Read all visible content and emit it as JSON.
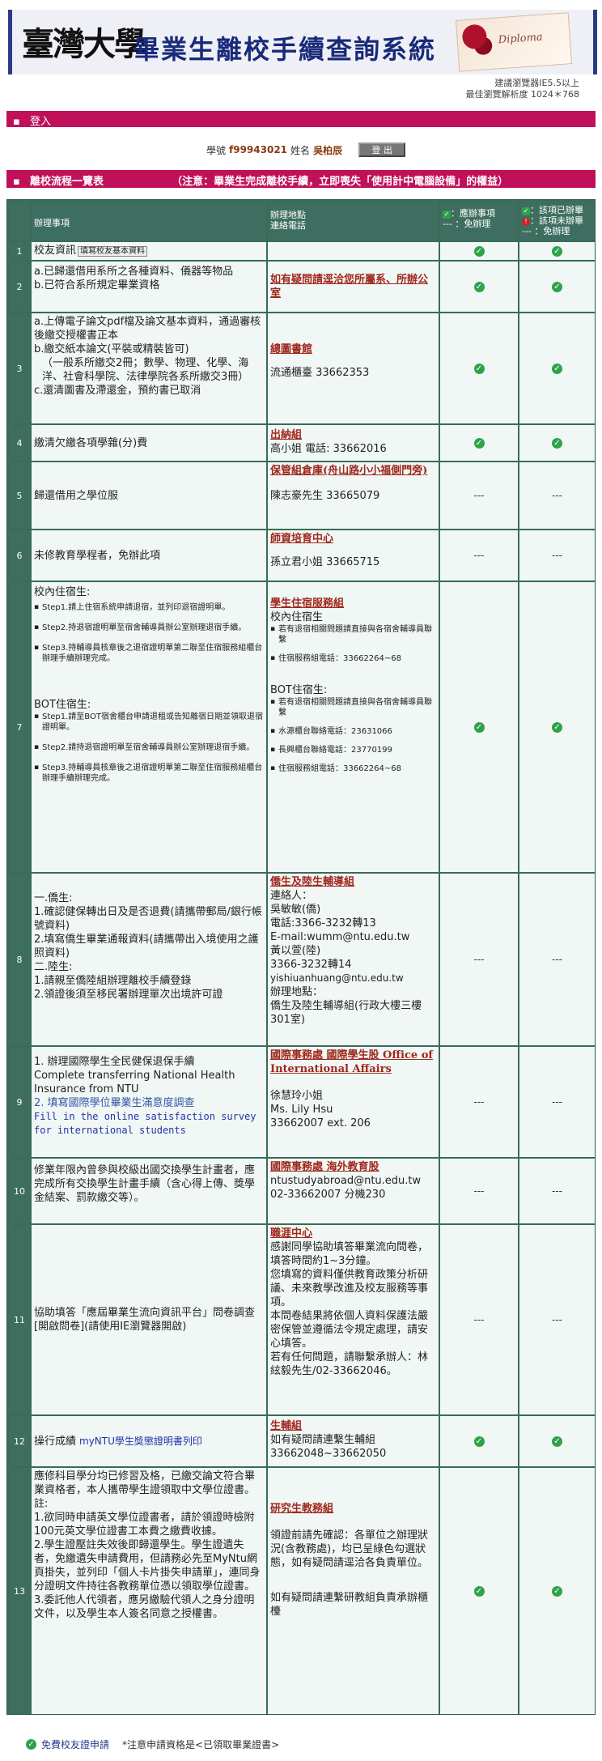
{
  "header": {
    "logo": "臺灣大學",
    "title": "畢業生離校手續查詢系統",
    "diploma_word": "Diploma",
    "browser_line1": "建議瀏覽器IE5.5以上",
    "browser_line2": "最佳瀏覽解析度 1024＊768"
  },
  "login_bar": {
    "label": "登入"
  },
  "student": {
    "id_label": "學號",
    "id_value": "f99943021",
    "name_label": "姓名",
    "name_value": "吳柏辰",
    "logout_label": "登 出"
  },
  "flow_bar": {
    "label": "離校流程一覽表",
    "note": "（注意：畢業生完成離校手續，立即喪失「使用計中電腦設備」的權益）"
  },
  "table": {
    "headers": {
      "item": "辦理事項",
      "contact": "辦理地點\n連絡電話",
      "col_a_line1": "：應辦事項",
      "col_a_line2": "--- ：免辦理",
      "col_b_line1": "：該項已辦畢",
      "col_b_line2": "：該項未辦畢",
      "col_b_line3": "--- ：免辦理"
    },
    "rows": [
      {
        "num": "1",
        "item": "校友資訊",
        "item_button": "填寫校友基本資料",
        "contact": "",
        "a": "check",
        "b": "check"
      },
      {
        "num": "2",
        "item_lines": [
          "a.已歸還借用系所之各種資料、儀器等物品",
          "b.已符合系所規定畢業資格"
        ],
        "contact_unit": "如有疑問請逕洽您所屬系、所辦公室",
        "a": "check",
        "b": "check"
      },
      {
        "num": "3",
        "item_lines": [
          "a.上傳電子論文pdf檔及論文基本資料，通過審核後繳交授權書正本",
          "b.繳交紙本論文(平裝或精裝皆可)",
          "（一般系所繳交2冊；數學、物理、化學、海洋、社會科學院、法律學院各系所繳交3冊）",
          "c.還清圖書及滯還金，預約書已取消"
        ],
        "contact_unit": "總圖書館",
        "contact_lines": [
          "流通櫃臺 33662353"
        ],
        "a": "check",
        "b": "check"
      },
      {
        "num": "4",
        "item": "繳清欠繳各項學雜(分)費",
        "contact_unit": "出納組",
        "contact_lines": [
          "高小姐 電話: 33662016"
        ],
        "a": "check",
        "b": "check"
      },
      {
        "num": "5",
        "item": "歸還借用之學位服",
        "contact_unit": "保管組倉庫(舟山路小小福側門旁)",
        "contact_lines": [
          "陳志豪先生 33665079"
        ],
        "a": "---",
        "b": "---"
      },
      {
        "num": "6",
        "item": "未修教育學程者，免辦此項",
        "contact_unit": "師資培育中心",
        "contact_lines": [
          "孫立君小姐 33665715"
        ],
        "a": "---",
        "b": "---"
      },
      {
        "num": "7",
        "item_campus_title": "校內住宿生:",
        "item_campus_steps": [
          "Step1.請上住宿系統申請退宿，並列印退宿證明單。",
          "Step2.持退宿證明單至宿舍輔導員辦公室辦理退宿手續。",
          "Step3.持輔導員核章後之退宿證明單第二聯至住宿服務組櫃台辦理手續辦理完成。"
        ],
        "item_bot_title": "BOT住宿生:",
        "item_bot_steps": [
          "Step1.請至BOT宿舍櫃台申請退租或告知離宿日期並領取退宿證明單。",
          "Step2.請持退宿證明單至宿舍輔導員辦公室辦理退宿手續。",
          "Step3.持輔導員核章後之退宿證明單第二聯至住宿服務組櫃台辦理手續辦理完成。"
        ],
        "contact_unit": "學生住宿服務組",
        "contact_campus_title": "校內住宿生",
        "contact_campus_items": [
          "若有退宿相關問題請直接與各宿舍輔導員聯繫",
          "住宿服務組電話：33662264~68"
        ],
        "contact_bot_title": "BOT住宿生:",
        "contact_bot_items": [
          "若有退宿相關問題請直接與各宿舍輔導員聯繫",
          "水源櫃台聯絡電話：23631066",
          "長興櫃台聯絡電話：23770199",
          "住宿服務組電話：33662264~68"
        ],
        "a": "check",
        "b": "check"
      },
      {
        "num": "8",
        "item_lines": [
          "一.僑生:",
          "1.確認健保轉出日及是否退費(請攜帶郵局/銀行帳號資料)",
          "2.填寫僑生畢業通報資料(請攜帶出入境使用之護照資料)",
          "二.陸生:",
          "1.請親至僑陸組辦理離校手續登錄",
          "2.領證後須至移民署辦理單次出境許可證"
        ],
        "contact_unit": "僑生及陸生輔導組",
        "contact_lines": [
          "連絡人：",
          "吳敏敏(僑)",
          "電話:3366-3232轉13",
          "E-mail:wumm@ntu.edu.tw",
          "黃以萱(陸)",
          "3366-3232轉14",
          "yishiuanhuang@ntu.edu.tw",
          "辦理地點：",
          "僑生及陸生輔導組(行政大樓三樓301室)"
        ],
        "a": "---",
        "b": "---"
      },
      {
        "num": "9",
        "item_lines": [
          "1. 辦理國際學生全民健保退保手續",
          "Complete transferring National Health Insurance from NTU",
          "2. 填寫國際學位畢業生滿意度調查",
          "Fill in the online satisfaction survey for international students"
        ],
        "contact_unit": "國際事務處 國際學生股 Office of International Affairs",
        "contact_lines": [
          "徐慧玲小姐",
          "Ms. Lily Hsu",
          "33662007 ext. 206"
        ],
        "a": "---",
        "b": "---"
      },
      {
        "num": "10",
        "item": "修業年限內曾參與校級出國交換學生計畫者，應完成所有交換學生計畫手續（含心得上傳、獎學金結案、罰款繳交等）。",
        "contact_unit": "國際事務處 海外教育股",
        "contact_lines": [
          "ntustudyabroad@ntu.edu.tw",
          "02-33662007 分機230"
        ],
        "a": "---",
        "b": "---"
      },
      {
        "num": "11",
        "item_lines": [
          "協助填答「應屆畢業生流向資訊平台」問卷調查[開啟問卷](請使用IE瀏覽器開啟)"
        ],
        "contact_unit": "職涯中心",
        "contact_lines": [
          "感謝同學協助填答畢業流向問卷，填答時間約1~3分鐘。",
          "您填寫的資料僅供教育政策分析研議、未來教學改進及校友服務等事項。",
          "本問卷結果將依個人資料保護法嚴密保管並遵循法令規定處理，請安心填答。",
          "若有任何問題，請聯繫承辦人：林絃毅先生/02-33662046。"
        ],
        "a": "---",
        "b": "---"
      },
      {
        "num": "12",
        "item": "操行成績",
        "item_link": "myNTU學生獎懲證明書列印",
        "contact_unit": "生輔組",
        "contact_lines": [
          "如有疑問請連繫生輔組",
          "33662048~33662050"
        ],
        "a": "check",
        "b": "check"
      },
      {
        "num": "13",
        "item_lines": [
          "應修科目學分均已修習及格，已繳交論文符合畢業資格者，本人攜帶學生證領取中文學位證書。",
          "註:",
          "1.欲同時申請英文學位證書者，請於領證時檢附100元英文學位證書工本費之繳費收據。",
          "2.學生證壓註失效後即歸還學生。學生證遺失者，免繳遺失申請費用，但請務必先至MyNtu網頁掛失，並列印「個人卡片掛失申請單」，連同身分證明文件持往各教務單位憑以領取學位證書。",
          "3.委託他人代領者，應另繳驗代領人之身分證明文件，以及學生本人簽名同意之授權書。"
        ],
        "contact_unit": "研究生教務組",
        "contact_lines": [
          "領證前請先確認：各單位之辦理狀況(含教務處)，均已呈綠色勾選狀態，如有疑問請逕洽各負責單位。",
          "如有疑問請連繫研教組負責承辦櫃檯"
        ],
        "a": "check",
        "b": "check"
      }
    ]
  },
  "footer": {
    "link": "免費校友證申請",
    "note": "*注意申請資格是<已領取畢業證書>"
  }
}
